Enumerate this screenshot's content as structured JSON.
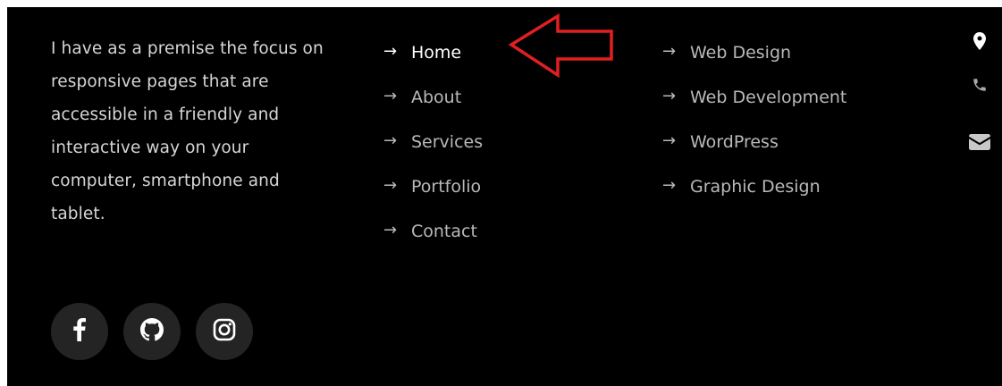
{
  "footer": {
    "about_text": "I have as a premise the focus on responsive pages that are accessible in a friendly and interactive way on your computer, smartphone and tablet.",
    "arrow_glyph": "→",
    "nav_links": [
      {
        "label": "Home",
        "active": true
      },
      {
        "label": "About",
        "active": false
      },
      {
        "label": "Services",
        "active": false
      },
      {
        "label": "Portfolio",
        "active": false
      },
      {
        "label": "Contact",
        "active": false
      }
    ],
    "service_links": [
      {
        "label": "Web Design"
      },
      {
        "label": "Web Development"
      },
      {
        "label": "WordPress"
      },
      {
        "label": "Graphic Design"
      }
    ],
    "social_icons": [
      "facebook-icon",
      "github-icon",
      "instagram-icon"
    ],
    "contact_icons": [
      "map-marker-icon",
      "phone-icon",
      "envelope-icon"
    ]
  },
  "annotation": {
    "arrow_icon": "annotation-arrow-left",
    "color": "#e02020"
  },
  "colors": {
    "background": "#000000",
    "text": "#d6d6d6",
    "link": "#b9b9b9",
    "link_active": "#ffffff",
    "social_bg": "#242424"
  }
}
